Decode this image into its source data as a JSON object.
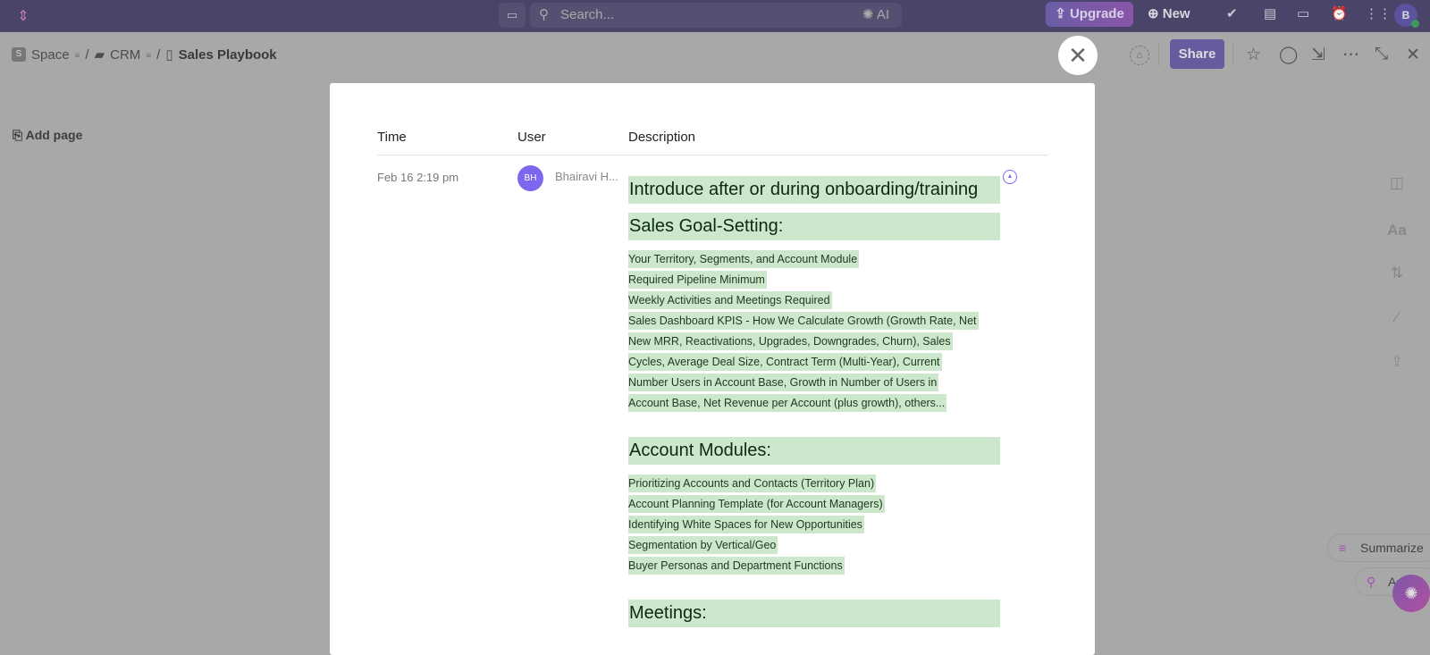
{
  "topbar": {
    "search_placeholder": "Search...",
    "ai_label": "AI",
    "upgrade_label": "Upgrade",
    "new_label": "New",
    "avatar_initial": "B"
  },
  "breadcrumb": {
    "space": "Space",
    "space_initial": "S",
    "folder": "CRM",
    "page": "Sales Playbook"
  },
  "sidebar": {
    "add_page": "Add page"
  },
  "toolbar": {
    "share_label": "Share"
  },
  "assistant": {
    "summarize": "Summarize",
    "ask_ai": "Ask AI"
  },
  "history": {
    "columns": {
      "time": "Time",
      "user": "User",
      "description": "Description"
    },
    "row": {
      "time": "Feb 16 2:19 pm",
      "user_initials": "BH",
      "user_name": "Bhairavi H...",
      "sections": [
        {
          "heading": "Introduce after or during onboarding/training",
          "lines": []
        },
        {
          "heading": "Sales Goal-Setting:",
          "lines": [
            "Your Territory, Segments, and Account Module",
            "Required Pipeline Minimum",
            "Weekly Activities and Meetings Required",
            "Sales Dashboard KPIS - How We Calculate Growth (Growth Rate, Net",
            "New MRR, Reactivations, Upgrades, Downgrades, Churn), Sales",
            "Cycles, Average Deal Size, Contract Term (Multi-Year), Current",
            "Number Users in Account Base, Growth in Number of Users in",
            "Account Base, Net Revenue per Account (plus growth), others..."
          ]
        },
        {
          "heading": "Account Modules:",
          "lines": [
            "Prioritizing Accounts and Contacts (Territory Plan)",
            "Account Planning Template (for Account Managers)",
            "Identifying White Spaces for New Opportunities",
            "Segmentation by Vertical/Geo",
            "Buyer Personas and Department Functions"
          ]
        },
        {
          "heading": "Meetings:",
          "lines": []
        }
      ]
    }
  }
}
